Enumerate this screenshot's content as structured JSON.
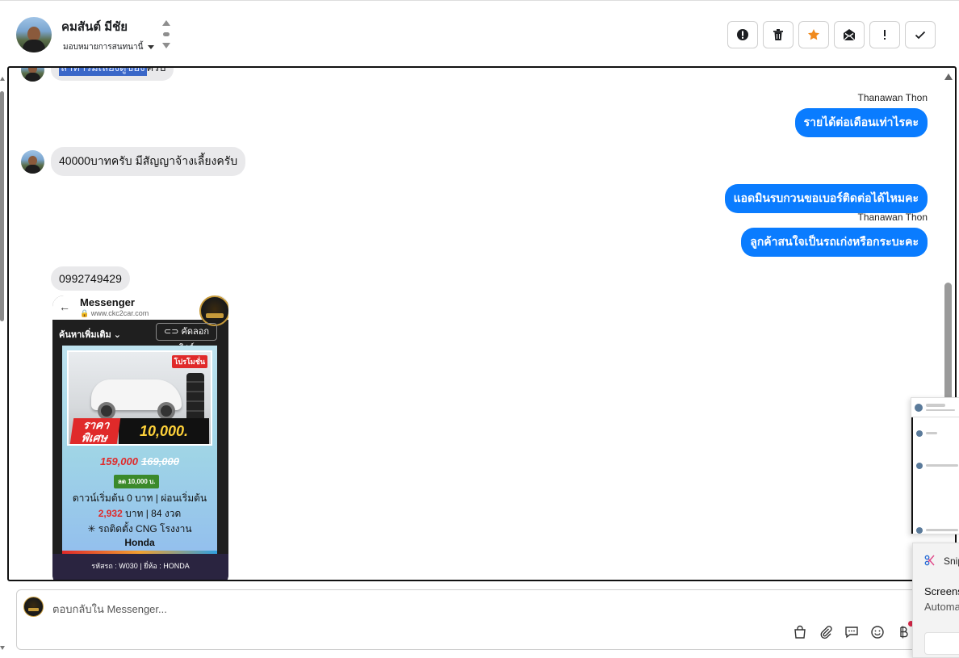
{
  "header": {
    "contact_name": "คมสันต์ มีชัย",
    "assign_label": "มอบหมายการสนทนานี้",
    "actions": [
      {
        "name": "report-button",
        "icon": "alert-circle-icon"
      },
      {
        "name": "delete-button",
        "icon": "trash-icon"
      },
      {
        "name": "star-button",
        "icon": "star-icon",
        "color": "#f08a1e"
      },
      {
        "name": "mark-unread-button",
        "icon": "mail-open-icon"
      },
      {
        "name": "important-button",
        "icon": "exclamation-icon"
      },
      {
        "name": "done-button",
        "icon": "check-icon"
      }
    ]
  },
  "messages": {
    "cutoff_text_highlight": "ลาทารมิเลยงดูของ",
    "cutoff_text_rest": "ครับ",
    "sender_1": "Thanawan Thon",
    "out_1": "รายได้ต่อเดือนเท่าไรคะ",
    "in_1": "40000บาทครับ  มีสัญญาจ้างเลี้ยงครับ",
    "out_2": "แอดมินรบกวนขอเบอร์ติดต่อได้ไหมคะ",
    "sender_2": "Thanawan Thon",
    "out_3": "ลูกค้าสนใจเป็นรถเก่งหรือกระบะคะ",
    "in_2": "0992749429"
  },
  "shared_image": {
    "app_title": "Messenger",
    "url": "www.ckc2car.com",
    "search_more": "ค้นหาเพิ่มเติม",
    "copy_link": "คัดลอกลิงค์",
    "promo_tag": "โปรโมชั่น",
    "promo_left": "ราคาพิเศษ",
    "promo_amount": "10,000.",
    "price_now": "159,000",
    "price_was": "169,000",
    "discount": "ลด 10,000 บ.",
    "line_1": "ดาวน์เริ่มต้น 0 บาท | ผ่อนเริ่มต้น",
    "line_2_amount": "2,932",
    "line_2_rest": " บาท | 84 งวด",
    "line_3": "✳ รถติดตั้ง CNG โรงงาน",
    "line_4": "Honda",
    "footer": "รหัสรถ : W030 | ยี่ห้อ : HONDA"
  },
  "composer": {
    "placeholder": "ตอบกลับใน Messenger..."
  },
  "snip": {
    "app": "Snipping Tool",
    "title": "Screenshot copied",
    "subtitle": "Automatically saved"
  },
  "colors": {
    "outgoing_bubble": "#0a7cff",
    "incoming_bubble": "#e9e9eb",
    "star": "#f08a1e"
  }
}
